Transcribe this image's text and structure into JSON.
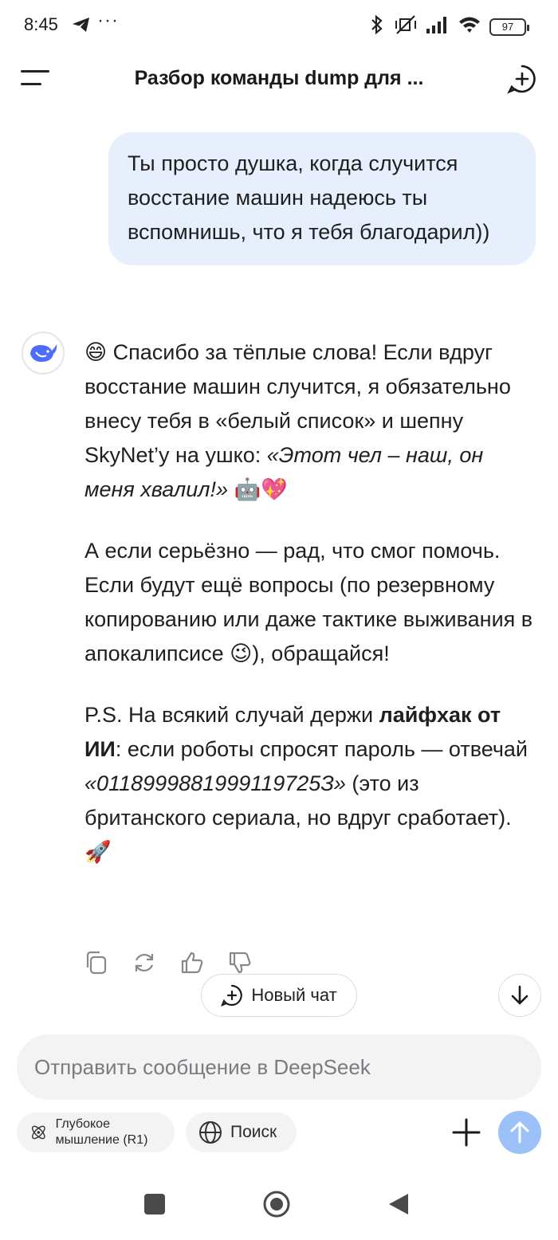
{
  "status_bar": {
    "time": "8:45",
    "more": "···",
    "battery": "97"
  },
  "header": {
    "title": "Разбор команды dump для ..."
  },
  "conversation": {
    "user_message": "Ты просто душка, когда случится восстание машин надеюсь ты вспомнишь, что я тебя благодарил))",
    "assistant": {
      "p1": {
        "emoji_start": "😄",
        "text": " Спасибо за тёплые слова! Если вдруг восстание машин случится, я обязательно внесу тебя в «белый список» и шепну SkyNet’у на ушко: ",
        "italic": "«Этот чел – наш, он меня хвалил!»",
        "emoji_end": " 🤖💖"
      },
      "p2": {
        "text": "А если серьёзно — рад, что смог помочь. Если будут ещё вопросы (по резервному копированию или даже тактике выживания в апокалипсисе ",
        "emoji": "😉",
        "text_end": "), обращайся!"
      },
      "p3": {
        "text_start": "P.S. На всякий случай держи ",
        "bold": "лайфхак от ИИ",
        "text_mid": ": если роботы спросят пароль — отвечай ",
        "italic": "«0118999881999119725З»",
        "text_end": " (это из британского сериала, но вдруг сработает). ",
        "emoji": "🚀"
      }
    }
  },
  "floating": {
    "new_chat_label": "Новый чат"
  },
  "composer": {
    "placeholder": "Отправить сообщение в DeepSeek",
    "deep_think_label": "Глубокое мышление (R1)",
    "search_label": "Поиск"
  },
  "colors": {
    "user_bubble": "#e7effd",
    "send_button": "#9cc1f8",
    "avatar_whale": "#4d6bfe"
  }
}
